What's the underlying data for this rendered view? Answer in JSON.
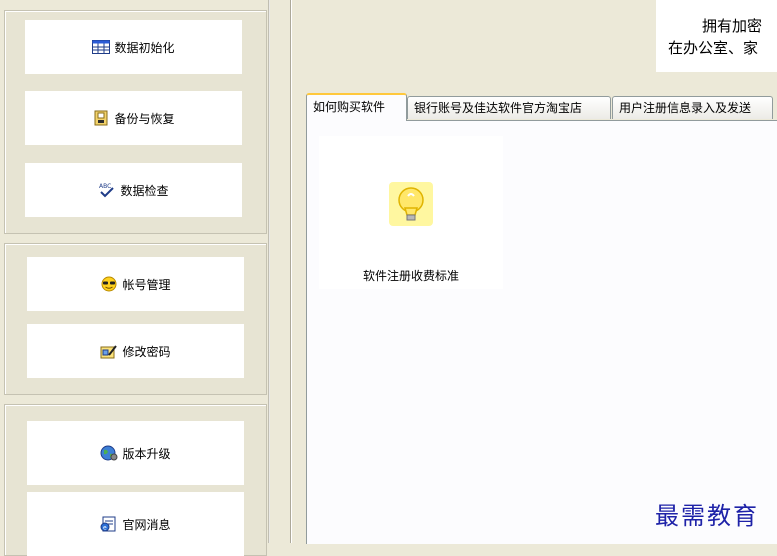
{
  "sidebar": {
    "groups": [
      {
        "items": [
          {
            "label": "数据初始化",
            "icon": "table-icon"
          },
          {
            "label": "备份与恢复",
            "icon": "backup-icon"
          },
          {
            "label": "数据检查",
            "icon": "spellcheck-icon"
          }
        ]
      },
      {
        "items": [
          {
            "label": "帐号管理",
            "icon": "user-sunglasses-icon"
          },
          {
            "label": "修改密码",
            "icon": "password-edit-icon"
          }
        ]
      },
      {
        "items": [
          {
            "label": "版本升级",
            "icon": "globe-icon"
          },
          {
            "label": "官网消息",
            "icon": "web-message-icon"
          }
        ]
      }
    ]
  },
  "banner": {
    "line1": "拥有加密",
    "line2": "在办公室、家"
  },
  "tabs": [
    {
      "label": "如何购买软件",
      "active": true
    },
    {
      "label": "银行账号及佳达软件官方淘宝店",
      "active": false
    },
    {
      "label": "用户注册信息录入及发送",
      "active": false
    }
  ],
  "panel": {
    "tile_label": "软件注册收费标准",
    "tile_icon": "lightbulb-icon"
  },
  "watermark": "最需教育",
  "colors": {
    "background": "#ece9d8",
    "active_tab_accent": "#ffc83c",
    "watermark": "#1e22a8"
  }
}
